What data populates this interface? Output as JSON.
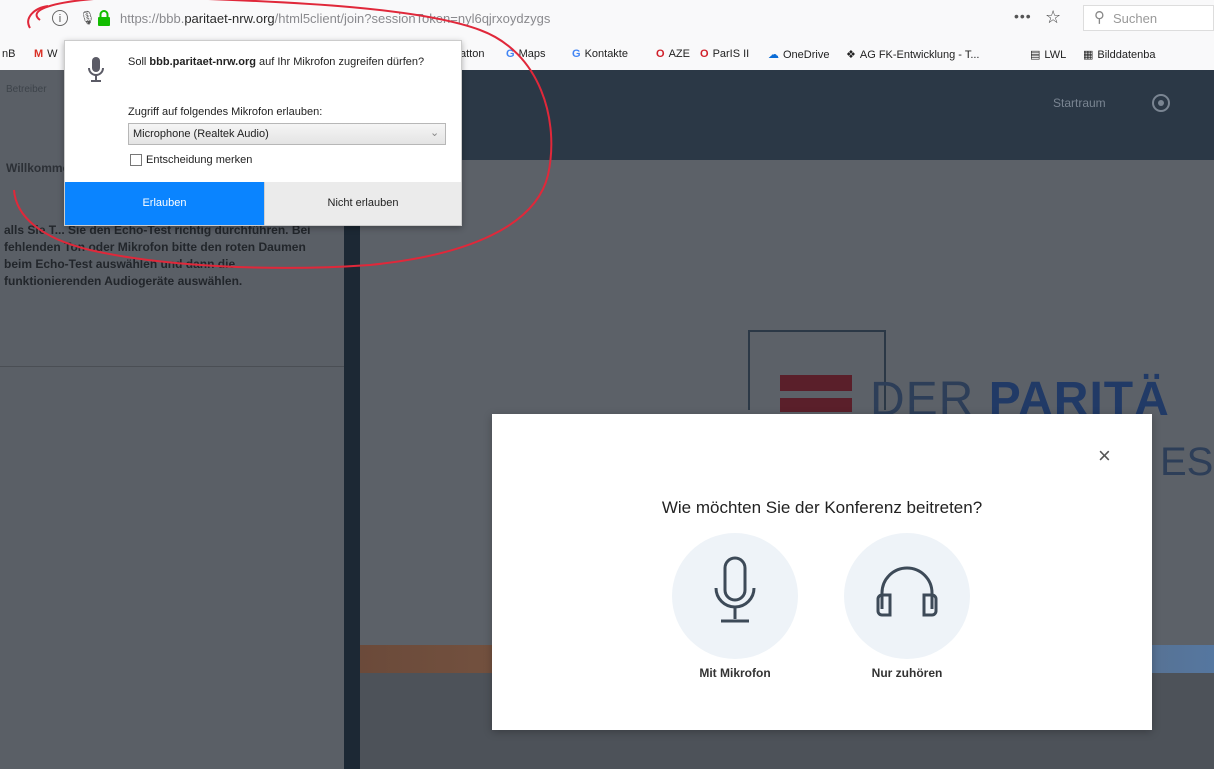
{
  "browser": {
    "url_prefix": "https://bbb.",
    "url_host": "paritaet-nrw.org",
    "url_path": "/html5client/join?sessionToken=nyl6qjrxoydzygs",
    "search_placeholder": "Suchen",
    "more_label": "•••",
    "star_icon": "star-icon",
    "info_icon": "i"
  },
  "bookmarks": [
    {
      "icon": "",
      "label": "nB"
    },
    {
      "icon": "M",
      "label": "W"
    },
    {
      "icon": "",
      "label": "atton"
    },
    {
      "icon": "G",
      "label": "Maps"
    },
    {
      "icon": "G",
      "label": "Kontakte"
    },
    {
      "icon": "O",
      "label": "AZE"
    },
    {
      "icon": "O",
      "label": "ParIS II"
    },
    {
      "icon": "☁",
      "label": "OneDrive"
    },
    {
      "icon": "❖",
      "label": "AG FK-Entwicklung - T..."
    },
    {
      "icon": "▤",
      "label": "LWL"
    },
    {
      "icon": "▦",
      "label": "Bilddatenba"
    }
  ],
  "permission_popup": {
    "question_prefix": "Soll ",
    "question_host": "bbb.paritaet-nrw.org",
    "question_suffix": " auf Ihr Mikrofon zugreifen dürfen?",
    "device_label": "Zugriff auf folgendes Mikrofon erlauben:",
    "device_value": "Microphone (Realtek Audio)",
    "remember_label": "Entscheidung merken",
    "allow_label": "Erlauben",
    "deny_label": "Nicht erlauben"
  },
  "sidebar": {
    "header_text": "Betreiber",
    "title": "Willkomme",
    "message": "alls Sie T... Sie den Echo-Test richtig durchführen. Bei fehlenden Ton oder Mikrofon bitte den roten Daumen beim Echo-Test auswählen und dann die funktionierenden Audiogeräte auswählen."
  },
  "topbar": {
    "record_label": "Startraum"
  },
  "logo": {
    "text_light": "DER ",
    "text_bold": "PARITÄ",
    "sub": "EST"
  },
  "modal": {
    "title": "Wie möchten Sie der Konferenz beitreten?",
    "close": "×",
    "option_mic_label": "Mit Mikrofon",
    "option_listen_label": "Nur zuhören"
  },
  "colors": {
    "annotation": "#e0283a",
    "allow_button": "#0a84ff",
    "topbar": "#2b3846",
    "logo_red": "#5a1f2a",
    "logo_blue": "#213a66"
  }
}
